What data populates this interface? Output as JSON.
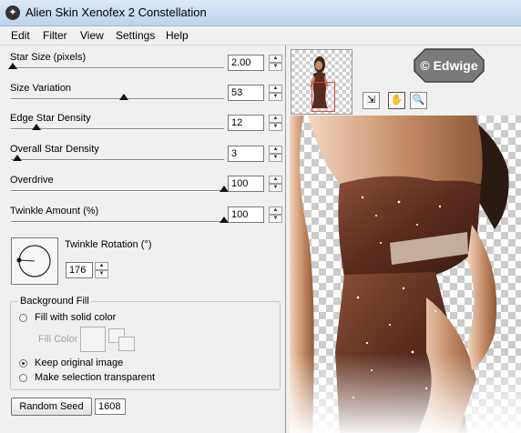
{
  "window": {
    "title": "Alien Skin Xenofex 2 Constellation"
  },
  "menu": {
    "items": [
      "Edit",
      "Filter",
      "View",
      "Settings",
      "Help"
    ]
  },
  "params": [
    {
      "label": "Star Size (pixels)",
      "value": "2.00",
      "level": 0.01
    },
    {
      "label": "Size Variation",
      "value": "53",
      "level": 0.53
    },
    {
      "label": "Edge Star Density",
      "value": "12",
      "level": 0.12
    },
    {
      "label": "Overall Star Density",
      "value": "3",
      "level": 0.03
    },
    {
      "label": "Overdrive",
      "value": "100",
      "level": 1.0
    },
    {
      "label": "Twinkle Amount (%)",
      "value": "100",
      "level": 1.0
    }
  ],
  "rotation": {
    "label": "Twinkle Rotation (°)",
    "value": "176"
  },
  "background_fill": {
    "legend": "Background Fill",
    "options": [
      "Fill with solid color",
      "Keep original image",
      "Make selection transparent"
    ],
    "selected": 1,
    "fill_color_label": "Fill Color"
  },
  "seed": {
    "button_label": "Random Seed",
    "value": "1608"
  },
  "watermark": {
    "text": "© Edwige"
  },
  "tools": [
    "zoom-fit-icon",
    "hand-icon",
    "magnifier-icon"
  ],
  "colors": {
    "dress": "#5a2c1e",
    "skin": "#c48c65",
    "titlebar": "#c9dcef"
  }
}
